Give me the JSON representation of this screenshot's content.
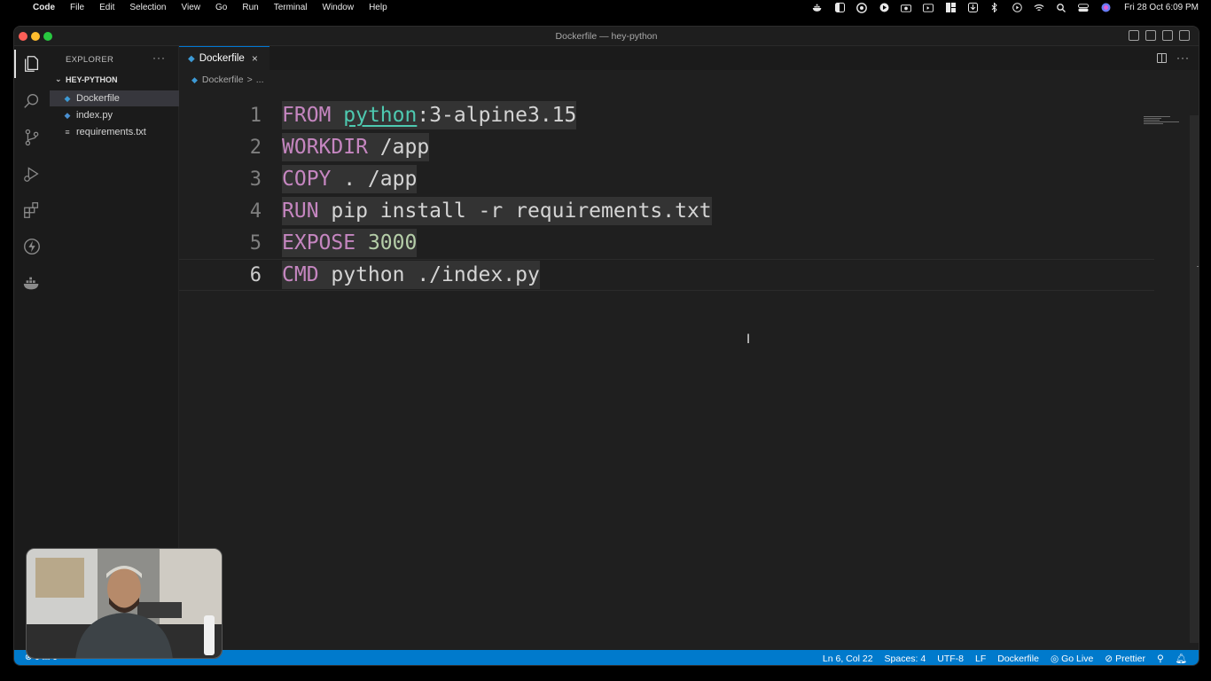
{
  "menubar": {
    "app": "Code",
    "items": [
      "File",
      "Edit",
      "Selection",
      "View",
      "Go",
      "Run",
      "Terminal",
      "Window",
      "Help"
    ],
    "tray_icons": [
      "docker-icon",
      "sidebar-icon",
      "chrome-icon",
      "play-circle-icon",
      "camera-icon",
      "screen-icon",
      "grid-icon",
      "download-icon",
      "bluetooth-icon",
      "record-icon",
      "wifi-icon",
      "search-icon",
      "control-center-icon",
      "siri-icon"
    ],
    "clock": "Fri 28 Oct  6:09 PM"
  },
  "window": {
    "title": "Dockerfile — hey-python"
  },
  "sidebar": {
    "header": "EXPLORER",
    "more": "···",
    "folder": "HEY-PYTHON",
    "files": [
      {
        "name": "Dockerfile",
        "icon": "docker-icon"
      },
      {
        "name": "index.py",
        "icon": "python-icon"
      },
      {
        "name": "requirements.txt",
        "icon": "lines-icon"
      }
    ]
  },
  "tabs": [
    {
      "label": "Dockerfile",
      "close": "×"
    }
  ],
  "breadcrumb": {
    "file": "Dockerfile",
    "sep": ">",
    "rest": "..."
  },
  "editor": {
    "lines": [
      {
        "no": "1",
        "tokens": [
          {
            "t": "FROM",
            "c": "kw"
          },
          {
            "t": " ",
            "c": "plain"
          },
          {
            "t": "python",
            "c": "img"
          },
          {
            "t": ":3-alpine3.15",
            "c": "plain"
          }
        ]
      },
      {
        "no": "2",
        "tokens": [
          {
            "t": "WORKDIR",
            "c": "kw"
          },
          {
            "t": " /app",
            "c": "plain"
          }
        ]
      },
      {
        "no": "3",
        "tokens": [
          {
            "t": "COPY",
            "c": "kw"
          },
          {
            "t": " . /app",
            "c": "plain"
          }
        ]
      },
      {
        "no": "4",
        "tokens": [
          {
            "t": "RUN",
            "c": "kw"
          },
          {
            "t": " pip install -r requirements.txt",
            "c": "plain"
          }
        ]
      },
      {
        "no": "5",
        "tokens": [
          {
            "t": "EXPOSE",
            "c": "kw"
          },
          {
            "t": " ",
            "c": "plain"
          },
          {
            "t": "3000",
            "c": "num"
          }
        ]
      },
      {
        "no": "6",
        "tokens": [
          {
            "t": "CMD",
            "c": "kw"
          },
          {
            "t": " python ./index.py",
            "c": "plain"
          }
        ]
      }
    ],
    "current_line": 6
  },
  "statusbar": {
    "left": "⊗ 0 ⚠ 0",
    "position": "Ln 6, Col 22",
    "spaces": "Spaces: 4",
    "encoding": "UTF-8",
    "eol": "LF",
    "language": "Dockerfile",
    "go_live": "Go Live",
    "prettier": "Prettier"
  },
  "colors": {
    "keyword": "#c586c0",
    "image": "#4ec9b0",
    "number": "#b5cea8",
    "statusbar": "#007acc",
    "selection": "#333333"
  }
}
